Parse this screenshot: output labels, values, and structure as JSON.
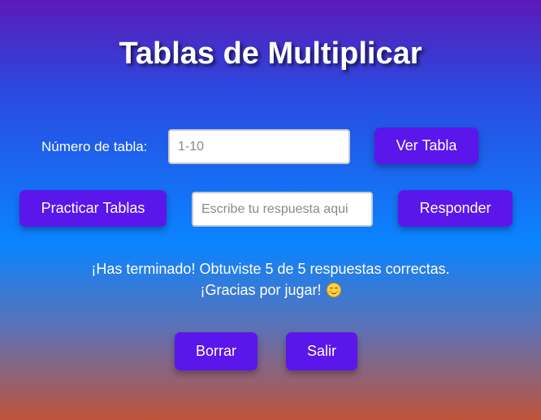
{
  "page": {
    "title": "Tablas de Multiplicar"
  },
  "table_row": {
    "label": "Número de tabla:",
    "input_placeholder": "1-10",
    "button_label": "Ver Tabla"
  },
  "practice_row": {
    "practice_button": "Practicar Tablas",
    "answer_placeholder": "Escribe tu respuesta aqui",
    "respond_button": "Responder"
  },
  "result": {
    "line1": "¡Has terminado! Obtuviste 5 de 5 respuestas correctas.",
    "line2": "¡Gracias por jugar!",
    "emoji_icon": "smiling-face-icon"
  },
  "actions": {
    "clear_button": "Borrar",
    "exit_button": "Salir"
  },
  "colors": {
    "button": "#5b16ec",
    "text": "#ffffff"
  }
}
